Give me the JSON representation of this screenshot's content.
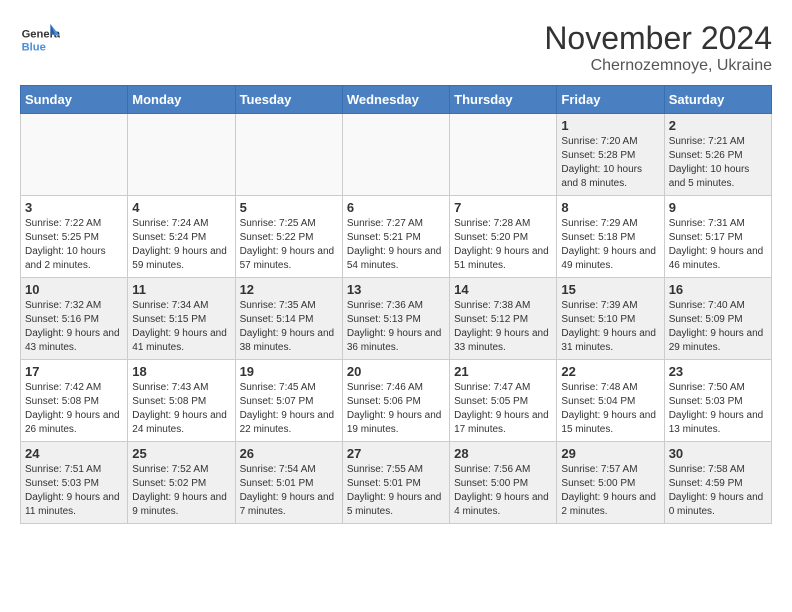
{
  "logo": {
    "line1": "General",
    "line2": "Blue"
  },
  "title": "November 2024",
  "subtitle": "Chernozemnoye, Ukraine",
  "days_of_week": [
    "Sunday",
    "Monday",
    "Tuesday",
    "Wednesday",
    "Thursday",
    "Friday",
    "Saturday"
  ],
  "weeks": [
    [
      {
        "day": "",
        "info": "",
        "empty": true
      },
      {
        "day": "",
        "info": "",
        "empty": true
      },
      {
        "day": "",
        "info": "",
        "empty": true
      },
      {
        "day": "",
        "info": "",
        "empty": true
      },
      {
        "day": "",
        "info": "",
        "empty": true
      },
      {
        "day": "1",
        "info": "Sunrise: 7:20 AM\nSunset: 5:28 PM\nDaylight: 10 hours\nand 8 minutes."
      },
      {
        "day": "2",
        "info": "Sunrise: 7:21 AM\nSunset: 5:26 PM\nDaylight: 10 hours\nand 5 minutes."
      }
    ],
    [
      {
        "day": "3",
        "info": "Sunrise: 7:22 AM\nSunset: 5:25 PM\nDaylight: 10 hours\nand 2 minutes."
      },
      {
        "day": "4",
        "info": "Sunrise: 7:24 AM\nSunset: 5:24 PM\nDaylight: 9 hours\nand 59 minutes."
      },
      {
        "day": "5",
        "info": "Sunrise: 7:25 AM\nSunset: 5:22 PM\nDaylight: 9 hours\nand 57 minutes."
      },
      {
        "day": "6",
        "info": "Sunrise: 7:27 AM\nSunset: 5:21 PM\nDaylight: 9 hours\nand 54 minutes."
      },
      {
        "day": "7",
        "info": "Sunrise: 7:28 AM\nSunset: 5:20 PM\nDaylight: 9 hours\nand 51 minutes."
      },
      {
        "day": "8",
        "info": "Sunrise: 7:29 AM\nSunset: 5:18 PM\nDaylight: 9 hours\nand 49 minutes."
      },
      {
        "day": "9",
        "info": "Sunrise: 7:31 AM\nSunset: 5:17 PM\nDaylight: 9 hours\nand 46 minutes."
      }
    ],
    [
      {
        "day": "10",
        "info": "Sunrise: 7:32 AM\nSunset: 5:16 PM\nDaylight: 9 hours\nand 43 minutes."
      },
      {
        "day": "11",
        "info": "Sunrise: 7:34 AM\nSunset: 5:15 PM\nDaylight: 9 hours\nand 41 minutes."
      },
      {
        "day": "12",
        "info": "Sunrise: 7:35 AM\nSunset: 5:14 PM\nDaylight: 9 hours\nand 38 minutes."
      },
      {
        "day": "13",
        "info": "Sunrise: 7:36 AM\nSunset: 5:13 PM\nDaylight: 9 hours\nand 36 minutes."
      },
      {
        "day": "14",
        "info": "Sunrise: 7:38 AM\nSunset: 5:12 PM\nDaylight: 9 hours\nand 33 minutes."
      },
      {
        "day": "15",
        "info": "Sunrise: 7:39 AM\nSunset: 5:10 PM\nDaylight: 9 hours\nand 31 minutes."
      },
      {
        "day": "16",
        "info": "Sunrise: 7:40 AM\nSunset: 5:09 PM\nDaylight: 9 hours\nand 29 minutes."
      }
    ],
    [
      {
        "day": "17",
        "info": "Sunrise: 7:42 AM\nSunset: 5:08 PM\nDaylight: 9 hours\nand 26 minutes."
      },
      {
        "day": "18",
        "info": "Sunrise: 7:43 AM\nSunset: 5:08 PM\nDaylight: 9 hours\nand 24 minutes."
      },
      {
        "day": "19",
        "info": "Sunrise: 7:45 AM\nSunset: 5:07 PM\nDaylight: 9 hours\nand 22 minutes."
      },
      {
        "day": "20",
        "info": "Sunrise: 7:46 AM\nSunset: 5:06 PM\nDaylight: 9 hours\nand 19 minutes."
      },
      {
        "day": "21",
        "info": "Sunrise: 7:47 AM\nSunset: 5:05 PM\nDaylight: 9 hours\nand 17 minutes."
      },
      {
        "day": "22",
        "info": "Sunrise: 7:48 AM\nSunset: 5:04 PM\nDaylight: 9 hours\nand 15 minutes."
      },
      {
        "day": "23",
        "info": "Sunrise: 7:50 AM\nSunset: 5:03 PM\nDaylight: 9 hours\nand 13 minutes."
      }
    ],
    [
      {
        "day": "24",
        "info": "Sunrise: 7:51 AM\nSunset: 5:03 PM\nDaylight: 9 hours\nand 11 minutes."
      },
      {
        "day": "25",
        "info": "Sunrise: 7:52 AM\nSunset: 5:02 PM\nDaylight: 9 hours\nand 9 minutes."
      },
      {
        "day": "26",
        "info": "Sunrise: 7:54 AM\nSunset: 5:01 PM\nDaylight: 9 hours\nand 7 minutes."
      },
      {
        "day": "27",
        "info": "Sunrise: 7:55 AM\nSunset: 5:01 PM\nDaylight: 9 hours\nand 5 minutes."
      },
      {
        "day": "28",
        "info": "Sunrise: 7:56 AM\nSunset: 5:00 PM\nDaylight: 9 hours\nand 4 minutes."
      },
      {
        "day": "29",
        "info": "Sunrise: 7:57 AM\nSunset: 5:00 PM\nDaylight: 9 hours\nand 2 minutes."
      },
      {
        "day": "30",
        "info": "Sunrise: 7:58 AM\nSunset: 4:59 PM\nDaylight: 9 hours\nand 0 minutes."
      }
    ]
  ]
}
